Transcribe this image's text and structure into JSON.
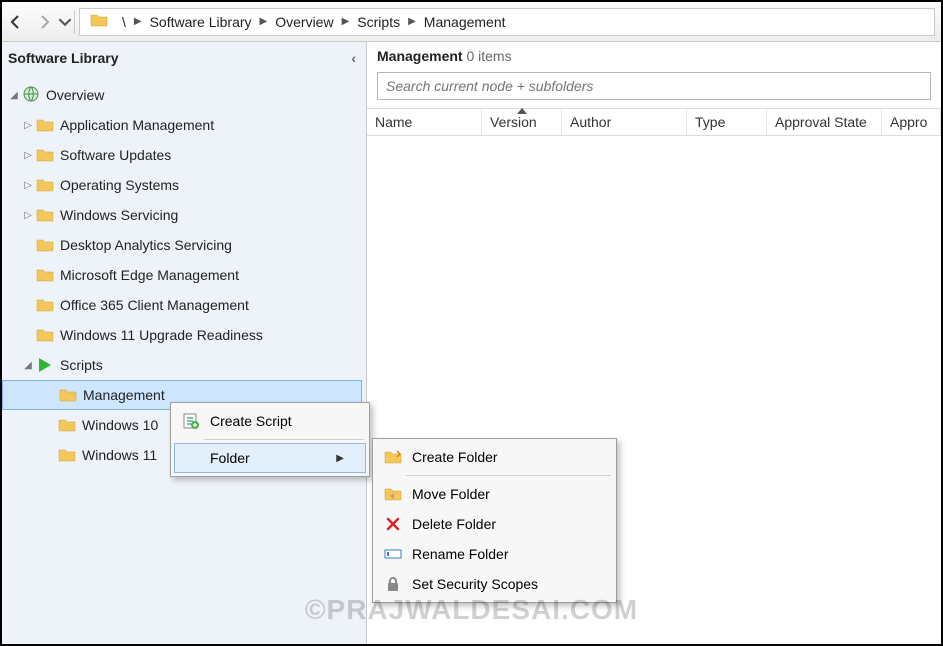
{
  "nav": {
    "breadcrumb": [
      "\\",
      "Software Library",
      "Overview",
      "Scripts",
      "Management"
    ]
  },
  "sidebar": {
    "title": "Software Library",
    "root": "Overview",
    "items": [
      {
        "label": "Application Management",
        "indent": 1,
        "expandable": true
      },
      {
        "label": "Software Updates",
        "indent": 1,
        "expandable": true
      },
      {
        "label": "Operating Systems",
        "indent": 1,
        "expandable": true
      },
      {
        "label": "Windows Servicing",
        "indent": 1,
        "expandable": true
      },
      {
        "label": "Desktop Analytics Servicing",
        "indent": 1,
        "expandable": false
      },
      {
        "label": "Microsoft Edge Management",
        "indent": 1,
        "expandable": false
      },
      {
        "label": "Office 365 Client Management",
        "indent": 1,
        "expandable": false
      },
      {
        "label": "Windows 11 Upgrade Readiness",
        "indent": 1,
        "expandable": false
      },
      {
        "label": "Scripts",
        "indent": 1,
        "expandable": true,
        "icon": "script",
        "expanded": true
      },
      {
        "label": "Management",
        "indent": 2,
        "selected": true
      },
      {
        "label": "Windows 10",
        "indent": 2
      },
      {
        "label": "Windows 11",
        "indent": 2
      }
    ]
  },
  "content": {
    "title": "Management",
    "count_text": "0 items",
    "search_placeholder": "Search current node + subfolders",
    "columns": [
      "Name",
      "Version",
      "Author",
      "Type",
      "Approval State",
      "Appro"
    ]
  },
  "context_menu": {
    "items": [
      {
        "label": "Create Script",
        "icon": "create-script"
      },
      {
        "label": "Folder",
        "icon": "",
        "submenu": true,
        "hover": true
      }
    ],
    "submenu": [
      {
        "label": "Create Folder",
        "icon": "folder-new"
      },
      {
        "label": "Move Folder",
        "icon": "folder-move"
      },
      {
        "label": "Delete Folder",
        "icon": "delete"
      },
      {
        "label": "Rename Folder",
        "icon": "rename"
      },
      {
        "label": "Set Security Scopes",
        "icon": "lock"
      }
    ]
  },
  "watermark": "©PRAJWALDESAI.COM"
}
